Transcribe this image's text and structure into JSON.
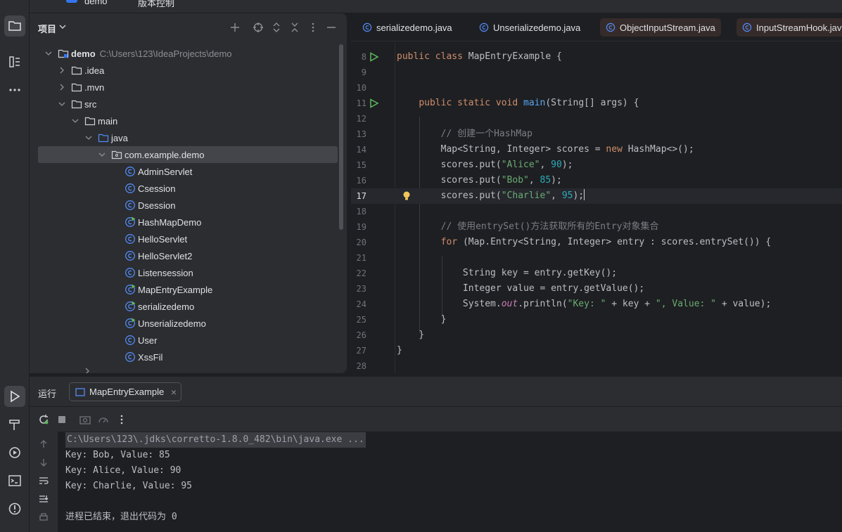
{
  "top": {
    "title1": "demo",
    "title2": "版本控制"
  },
  "project": {
    "title": "项目",
    "tree": [
      {
        "name": "demo",
        "path": "C:\\Users\\123\\IdeaProjects\\demo",
        "depth": 0,
        "arrow": "down",
        "icon": "module-folder-icon",
        "bold": true
      },
      {
        "name": ".idea",
        "depth": 1,
        "arrow": "right",
        "icon": "folder-icon"
      },
      {
        "name": ".mvn",
        "depth": 1,
        "arrow": "right",
        "icon": "folder-icon"
      },
      {
        "name": "src",
        "depth": 1,
        "arrow": "down",
        "icon": "folder-icon"
      },
      {
        "name": "main",
        "depth": 2,
        "arrow": "down",
        "icon": "folder-icon"
      },
      {
        "name": "java",
        "depth": 3,
        "arrow": "down",
        "icon": "source-folder-icon"
      },
      {
        "name": "com.example.demo",
        "depth": 4,
        "arrow": "down",
        "icon": "package-icon",
        "selected": true
      },
      {
        "name": "AdminServlet",
        "depth": 5,
        "icon": "class-icon"
      },
      {
        "name": "Csession",
        "depth": 5,
        "icon": "class-icon"
      },
      {
        "name": "Dsession",
        "depth": 5,
        "icon": "class-icon"
      },
      {
        "name": "HashMapDemo",
        "depth": 5,
        "icon": "runnable-class-icon"
      },
      {
        "name": "HelloServlet",
        "depth": 5,
        "icon": "class-icon"
      },
      {
        "name": "HelloServlet2",
        "depth": 5,
        "icon": "class-icon"
      },
      {
        "name": "Listensession",
        "depth": 5,
        "icon": "class-icon"
      },
      {
        "name": "MapEntryExample",
        "depth": 5,
        "icon": "runnable-class-icon"
      },
      {
        "name": "serializedemo",
        "depth": 5,
        "icon": "runnable-class-icon"
      },
      {
        "name": "Unserializedemo",
        "depth": 5,
        "icon": "runnable-class-icon"
      },
      {
        "name": "User",
        "depth": 5,
        "icon": "class-icon"
      },
      {
        "name": "XssFil",
        "depth": 5,
        "icon": "class-icon"
      }
    ]
  },
  "editor": {
    "tabs": [
      {
        "label": "serializedemo.java",
        "highlight": false
      },
      {
        "label": "Unserializedemo.java",
        "highlight": false
      },
      {
        "label": "ObjectInputStream.java",
        "highlight": true
      },
      {
        "label": "InputStreamHook.jav",
        "highlight": true
      }
    ],
    "current_line": 17,
    "lines": [
      {
        "n": "8",
        "run": true,
        "tokens": [
          [
            "kw",
            "public "
          ],
          [
            "kw",
            "class "
          ],
          [
            "cls",
            "MapEntryExample {"
          ]
        ]
      },
      {
        "n": "9",
        "tokens": []
      },
      {
        "n": "10",
        "tokens": []
      },
      {
        "n": "11",
        "run": true,
        "tokens": [
          [
            "",
            "    "
          ],
          [
            "kw",
            "public "
          ],
          [
            "kw",
            "static "
          ],
          [
            "kw",
            "void "
          ],
          [
            "fn",
            "main"
          ],
          [
            "",
            "(String[] args) {"
          ]
        ]
      },
      {
        "n": "12",
        "tokens": []
      },
      {
        "n": "13",
        "tokens": [
          [
            "",
            "        "
          ],
          [
            "cmt",
            "// 创建一个HashMap"
          ]
        ]
      },
      {
        "n": "14",
        "tokens": [
          [
            "",
            "        Map<String, Integer> scores = "
          ],
          [
            "kw",
            "new "
          ],
          [
            "",
            "HashMap<>();"
          ]
        ]
      },
      {
        "n": "15",
        "tokens": [
          [
            "",
            "        scores.put("
          ],
          [
            "str",
            "\"Alice\""
          ],
          [
            "",
            ", "
          ],
          [
            "num",
            "90"
          ],
          [
            "",
            ");"
          ]
        ]
      },
      {
        "n": "16",
        "tokens": [
          [
            "",
            "        scores.put("
          ],
          [
            "str",
            "\"Bob\""
          ],
          [
            "",
            ", "
          ],
          [
            "num",
            "85"
          ],
          [
            "",
            ");"
          ]
        ]
      },
      {
        "n": "17",
        "bulb": true,
        "tokens": [
          [
            "",
            "        scores.put("
          ],
          [
            "str",
            "\"Charlie\""
          ],
          [
            "",
            ", "
          ],
          [
            "num",
            "95"
          ],
          [
            "",
            ");"
          ]
        ]
      },
      {
        "n": "18",
        "tokens": []
      },
      {
        "n": "19",
        "tokens": [
          [
            "",
            "        "
          ],
          [
            "cmt",
            "// 使用entrySet()方法获取所有的Entry对象集合"
          ]
        ]
      },
      {
        "n": "20",
        "tokens": [
          [
            "",
            "        "
          ],
          [
            "kw",
            "for "
          ],
          [
            "",
            "(Map.Entry<String, Integer> entry : scores.entrySet()) {"
          ]
        ]
      },
      {
        "n": "21",
        "tokens": []
      },
      {
        "n": "22",
        "tokens": [
          [
            "",
            "            String key = entry.getKey();"
          ]
        ]
      },
      {
        "n": "23",
        "tokens": [
          [
            "",
            "            Integer value = entry.getValue();"
          ]
        ]
      },
      {
        "n": "24",
        "tokens": [
          [
            "",
            "            System."
          ],
          [
            "ital",
            "out"
          ],
          [
            "",
            ".println("
          ],
          [
            "str",
            "\"Key: \""
          ],
          [
            "",
            " + key + "
          ],
          [
            "str",
            "\", Value: \""
          ],
          [
            "",
            " + value);"
          ]
        ]
      },
      {
        "n": "25",
        "tokens": [
          [
            "",
            "        }"
          ]
        ]
      },
      {
        "n": "26",
        "tokens": [
          [
            "",
            "    }"
          ]
        ]
      },
      {
        "n": "27",
        "tokens": [
          [
            "",
            "}"
          ]
        ]
      },
      {
        "n": "28",
        "tokens": []
      }
    ]
  },
  "run": {
    "title": "运行",
    "tab_label": "MapEntryExample",
    "tab_close": "×",
    "output": [
      {
        "text": "C:\\Users\\123\\.jdks\\corretto-1.8.0_482\\bin\\java.exe ...",
        "cmd": true
      },
      {
        "text": "Key: Bob, Value: 85"
      },
      {
        "text": "Key: Alice, Value: 90"
      },
      {
        "text": "Key: Charlie, Value: 95"
      },
      {
        "text": ""
      },
      {
        "text": "进程已结束，退出代码为 0"
      }
    ]
  },
  "colors": {
    "accent": "#3574f0",
    "run_green": "#5fb85f",
    "bulb": "#f2c55c"
  }
}
